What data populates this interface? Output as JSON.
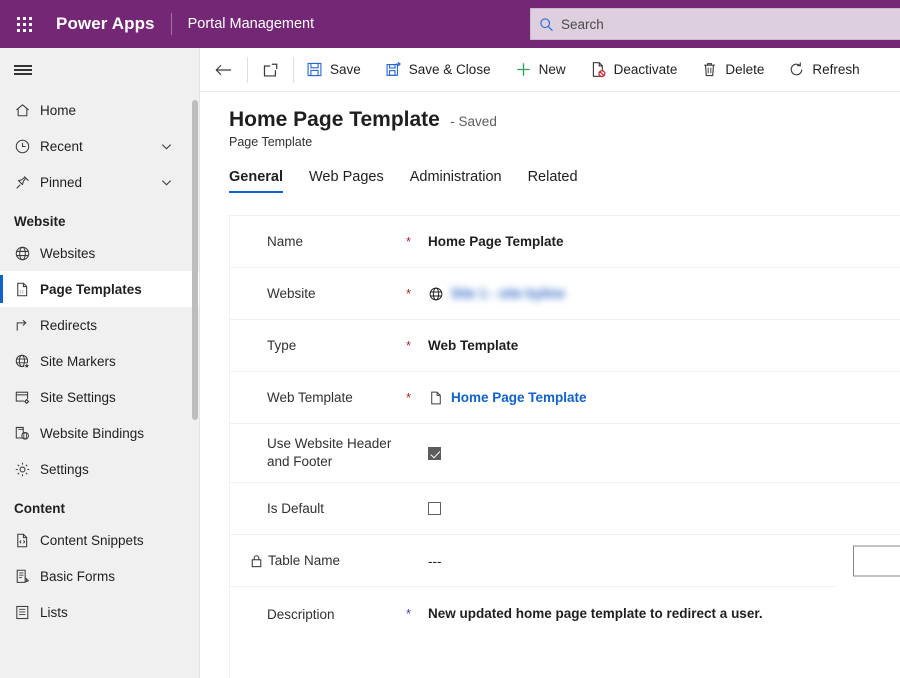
{
  "topbar": {
    "waffle_icon": "waffle-grid-icon",
    "brand": "Power Apps",
    "app_name": "Portal Management",
    "search": {
      "placeholder": "Search",
      "value": "",
      "icon": "search-icon"
    }
  },
  "sidebar": {
    "hamburger_icon": "hamburger-icon",
    "items": [
      {
        "label": "Home",
        "icon": "home-icon",
        "chevron": false,
        "selected": false
      },
      {
        "label": "Recent",
        "icon": "clock-icon",
        "chevron": true,
        "selected": false
      },
      {
        "label": "Pinned",
        "icon": "pin-icon",
        "chevron": true,
        "selected": false
      }
    ],
    "groups": [
      {
        "title": "Website",
        "items": [
          {
            "label": "Websites",
            "icon": "globe-icon",
            "selected": false
          },
          {
            "label": "Page Templates",
            "icon": "page-template-icon",
            "selected": true
          },
          {
            "label": "Redirects",
            "icon": "redirect-arrow-icon",
            "selected": false
          },
          {
            "label": "Site Markers",
            "icon": "globe-star-icon",
            "selected": false
          },
          {
            "label": "Site Settings",
            "icon": "site-settings-icon",
            "selected": false
          },
          {
            "label": "Website Bindings",
            "icon": "website-bindings-icon",
            "selected": false
          },
          {
            "label": "Settings",
            "icon": "gear-icon",
            "selected": false
          }
        ]
      },
      {
        "title": "Content",
        "items": [
          {
            "label": "Content Snippets",
            "icon": "code-document-icon",
            "selected": false
          },
          {
            "label": "Basic Forms",
            "icon": "form-edit-icon",
            "selected": false
          },
          {
            "label": "Lists",
            "icon": "list-icon",
            "selected": false
          }
        ]
      }
    ]
  },
  "commandbar": {
    "back": {
      "label": "",
      "icon": "back-arrow-icon"
    },
    "popout": {
      "label": "",
      "icon": "popout-icon"
    },
    "items": [
      {
        "label": "Save",
        "icon": "save-floppy-icon"
      },
      {
        "label": "Save & Close",
        "icon": "save-and-close-icon"
      },
      {
        "label": "New",
        "icon": "plus-icon"
      },
      {
        "label": "Deactivate",
        "icon": "deactivate-icon"
      },
      {
        "label": "Delete",
        "icon": "trash-icon"
      },
      {
        "label": "Refresh",
        "icon": "refresh-icon"
      }
    ]
  },
  "page": {
    "title": "Home Page Template",
    "status": "- Saved",
    "subtitle": "Page Template",
    "tabs": [
      {
        "label": "General",
        "active": true
      },
      {
        "label": "Web Pages",
        "active": false
      },
      {
        "label": "Administration",
        "active": false
      },
      {
        "label": "Related",
        "active": false
      }
    ]
  },
  "form": {
    "rows": [
      {
        "label": "Name",
        "required": true,
        "value": "Home Page Template"
      },
      {
        "label": "Website",
        "required": true,
        "value": "Site 1 - site byline",
        "redacted": true,
        "icon": "globe-icon"
      },
      {
        "label": "Type",
        "required": true,
        "value": "Web Template"
      },
      {
        "label": "Web Template",
        "required": true,
        "value": "Home Page Template",
        "link": true,
        "icon": "document-icon"
      },
      {
        "label": "Use Website Header and Footer",
        "required": false,
        "checkbox": true,
        "checked": true
      },
      {
        "label": "Is Default",
        "required": false,
        "checkbox": true,
        "checked": false
      },
      {
        "label": "Table Name",
        "required": false,
        "value": "---",
        "locked": true,
        "icon": "lock-icon",
        "side_input_value": ""
      },
      {
        "label": "Description",
        "required": true,
        "value": "New updated home page template to redirect a user."
      }
    ]
  },
  "colors": {
    "brand_purple": "#742774",
    "accent_blue": "#0f62cd",
    "required_red": "#a4262c",
    "sidebar_bg": "#f0f0f0"
  }
}
